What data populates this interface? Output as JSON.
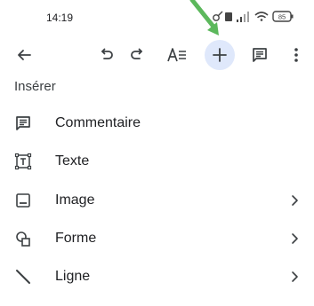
{
  "status_bar": {
    "time": "14:19",
    "battery": "85"
  },
  "toolbar": {
    "back_icon": "arrow-back-icon",
    "undo_icon": "undo-icon",
    "redo_icon": "redo-icon",
    "format_icon": "text-format-icon",
    "insert_icon": "add-icon",
    "comment_icon": "comment-icon",
    "more_icon": "more-vert-icon"
  },
  "menu": {
    "title": "Insérer",
    "items": [
      {
        "label": "Commentaire",
        "icon": "comment-icon",
        "has_submenu": false
      },
      {
        "label": "Texte",
        "icon": "text-box-icon",
        "has_submenu": false
      },
      {
        "label": "Image",
        "icon": "image-icon",
        "has_submenu": true
      },
      {
        "label": "Forme",
        "icon": "shapes-icon",
        "has_submenu": true
      },
      {
        "label": "Ligne",
        "icon": "line-icon",
        "has_submenu": true
      }
    ]
  },
  "colors": {
    "accent": "#4caf50",
    "active_bg": "#dfe8fb",
    "text": "#202124"
  }
}
